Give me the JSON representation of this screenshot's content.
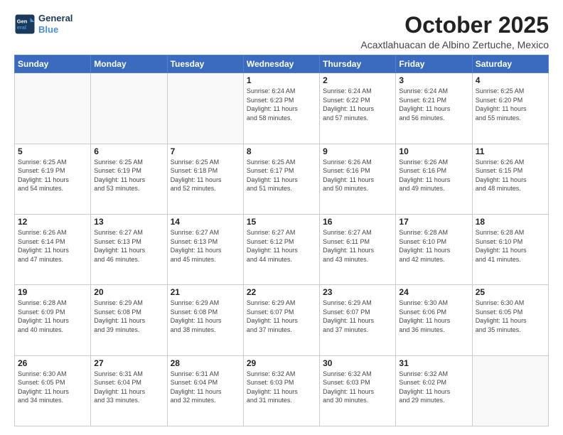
{
  "header": {
    "logo_line1": "General",
    "logo_line2": "Blue",
    "month": "October 2025",
    "location": "Acaxtlahuacan de Albino Zertuche, Mexico"
  },
  "days_of_week": [
    "Sunday",
    "Monday",
    "Tuesday",
    "Wednesday",
    "Thursday",
    "Friday",
    "Saturday"
  ],
  "weeks": [
    [
      {
        "day": "",
        "info": ""
      },
      {
        "day": "",
        "info": ""
      },
      {
        "day": "",
        "info": ""
      },
      {
        "day": "1",
        "info": "Sunrise: 6:24 AM\nSunset: 6:23 PM\nDaylight: 11 hours\nand 58 minutes."
      },
      {
        "day": "2",
        "info": "Sunrise: 6:24 AM\nSunset: 6:22 PM\nDaylight: 11 hours\nand 57 minutes."
      },
      {
        "day": "3",
        "info": "Sunrise: 6:24 AM\nSunset: 6:21 PM\nDaylight: 11 hours\nand 56 minutes."
      },
      {
        "day": "4",
        "info": "Sunrise: 6:25 AM\nSunset: 6:20 PM\nDaylight: 11 hours\nand 55 minutes."
      }
    ],
    [
      {
        "day": "5",
        "info": "Sunrise: 6:25 AM\nSunset: 6:19 PM\nDaylight: 11 hours\nand 54 minutes."
      },
      {
        "day": "6",
        "info": "Sunrise: 6:25 AM\nSunset: 6:19 PM\nDaylight: 11 hours\nand 53 minutes."
      },
      {
        "day": "7",
        "info": "Sunrise: 6:25 AM\nSunset: 6:18 PM\nDaylight: 11 hours\nand 52 minutes."
      },
      {
        "day": "8",
        "info": "Sunrise: 6:25 AM\nSunset: 6:17 PM\nDaylight: 11 hours\nand 51 minutes."
      },
      {
        "day": "9",
        "info": "Sunrise: 6:26 AM\nSunset: 6:16 PM\nDaylight: 11 hours\nand 50 minutes."
      },
      {
        "day": "10",
        "info": "Sunrise: 6:26 AM\nSunset: 6:16 PM\nDaylight: 11 hours\nand 49 minutes."
      },
      {
        "day": "11",
        "info": "Sunrise: 6:26 AM\nSunset: 6:15 PM\nDaylight: 11 hours\nand 48 minutes."
      }
    ],
    [
      {
        "day": "12",
        "info": "Sunrise: 6:26 AM\nSunset: 6:14 PM\nDaylight: 11 hours\nand 47 minutes."
      },
      {
        "day": "13",
        "info": "Sunrise: 6:27 AM\nSunset: 6:13 PM\nDaylight: 11 hours\nand 46 minutes."
      },
      {
        "day": "14",
        "info": "Sunrise: 6:27 AM\nSunset: 6:13 PM\nDaylight: 11 hours\nand 45 minutes."
      },
      {
        "day": "15",
        "info": "Sunrise: 6:27 AM\nSunset: 6:12 PM\nDaylight: 11 hours\nand 44 minutes."
      },
      {
        "day": "16",
        "info": "Sunrise: 6:27 AM\nSunset: 6:11 PM\nDaylight: 11 hours\nand 43 minutes."
      },
      {
        "day": "17",
        "info": "Sunrise: 6:28 AM\nSunset: 6:10 PM\nDaylight: 11 hours\nand 42 minutes."
      },
      {
        "day": "18",
        "info": "Sunrise: 6:28 AM\nSunset: 6:10 PM\nDaylight: 11 hours\nand 41 minutes."
      }
    ],
    [
      {
        "day": "19",
        "info": "Sunrise: 6:28 AM\nSunset: 6:09 PM\nDaylight: 11 hours\nand 40 minutes."
      },
      {
        "day": "20",
        "info": "Sunrise: 6:29 AM\nSunset: 6:08 PM\nDaylight: 11 hours\nand 39 minutes."
      },
      {
        "day": "21",
        "info": "Sunrise: 6:29 AM\nSunset: 6:08 PM\nDaylight: 11 hours\nand 38 minutes."
      },
      {
        "day": "22",
        "info": "Sunrise: 6:29 AM\nSunset: 6:07 PM\nDaylight: 11 hours\nand 37 minutes."
      },
      {
        "day": "23",
        "info": "Sunrise: 6:29 AM\nSunset: 6:07 PM\nDaylight: 11 hours\nand 37 minutes."
      },
      {
        "day": "24",
        "info": "Sunrise: 6:30 AM\nSunset: 6:06 PM\nDaylight: 11 hours\nand 36 minutes."
      },
      {
        "day": "25",
        "info": "Sunrise: 6:30 AM\nSunset: 6:05 PM\nDaylight: 11 hours\nand 35 minutes."
      }
    ],
    [
      {
        "day": "26",
        "info": "Sunrise: 6:30 AM\nSunset: 6:05 PM\nDaylight: 11 hours\nand 34 minutes."
      },
      {
        "day": "27",
        "info": "Sunrise: 6:31 AM\nSunset: 6:04 PM\nDaylight: 11 hours\nand 33 minutes."
      },
      {
        "day": "28",
        "info": "Sunrise: 6:31 AM\nSunset: 6:04 PM\nDaylight: 11 hours\nand 32 minutes."
      },
      {
        "day": "29",
        "info": "Sunrise: 6:32 AM\nSunset: 6:03 PM\nDaylight: 11 hours\nand 31 minutes."
      },
      {
        "day": "30",
        "info": "Sunrise: 6:32 AM\nSunset: 6:03 PM\nDaylight: 11 hours\nand 30 minutes."
      },
      {
        "day": "31",
        "info": "Sunrise: 6:32 AM\nSunset: 6:02 PM\nDaylight: 11 hours\nand 29 minutes."
      },
      {
        "day": "",
        "info": ""
      }
    ]
  ]
}
